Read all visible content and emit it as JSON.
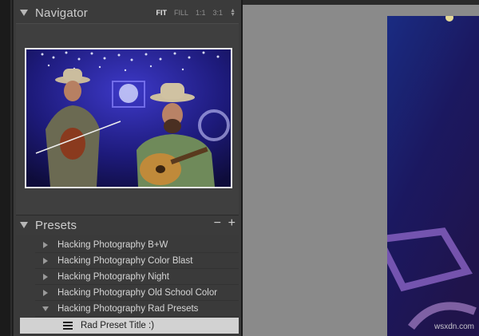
{
  "navigator": {
    "title": "Navigator",
    "zoom_options": [
      "FIT",
      "FILL",
      "1:1",
      "3:1"
    ],
    "active_zoom": "FIT"
  },
  "presets": {
    "title": "Presets",
    "remove_label": "−",
    "add_label": "+",
    "items": [
      {
        "label": "Hacking Photography B+W",
        "expanded": false
      },
      {
        "label": "Hacking Photography Color Blast",
        "expanded": false
      },
      {
        "label": "Hacking Photography Night",
        "expanded": false
      },
      {
        "label": "Hacking Photography Old School Color",
        "expanded": false
      },
      {
        "label": "Hacking Photography Rad Presets",
        "expanded": true
      }
    ],
    "selected_child": {
      "label": "Rad Preset Title :)"
    }
  },
  "watermark": "wsxdn.com",
  "colors": {
    "panel_bg": "#3b3b3b",
    "canvas_bg": "#8a8a8a",
    "selected_row": "#d2d2d2",
    "photo_stage_light": "#4a3bd0"
  }
}
